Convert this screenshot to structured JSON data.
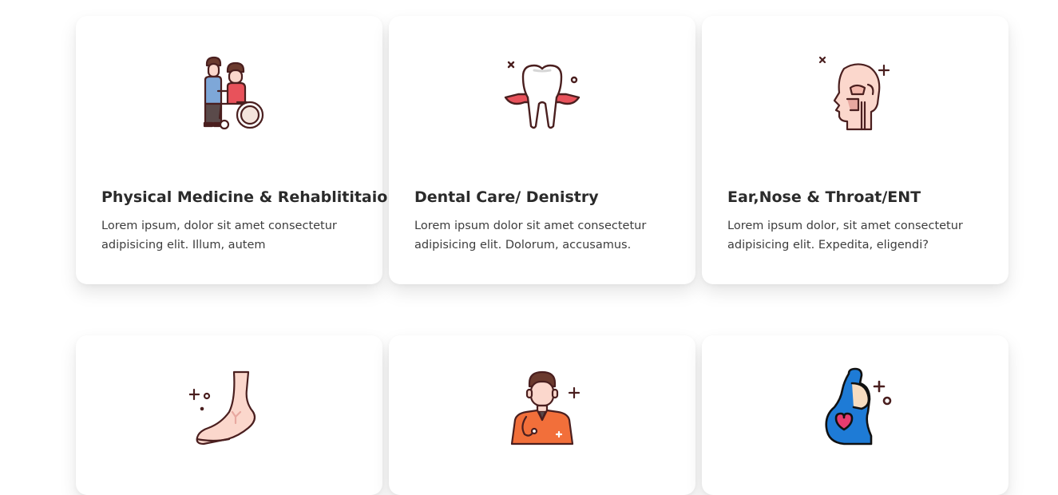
{
  "services": [
    {
      "title": "Physical Medicine & Rehablititaion",
      "description": "Lorem ipsum, dolor sit amet consectetur adipisicing elit. Illum, autem",
      "icon": "wheelchair-rehab-icon"
    },
    {
      "title": "Dental Care/ Denistry",
      "description": "Lorem ipsum dolor sit amet consectetur adipisicing elit. Dolorum, accusamus.",
      "icon": "tooth-icon"
    },
    {
      "title": "Ear,Nose & Throat/ENT",
      "description": "Lorem ipsum dolor, sit amet consectetur adipisicing elit. Expedita, eligendi?",
      "icon": "head-anatomy-icon"
    },
    {
      "title": "",
      "description": "",
      "icon": "foot-icon"
    },
    {
      "title": "",
      "description": "",
      "icon": "doctor-icon"
    },
    {
      "title": "",
      "description": "",
      "icon": "pregnancy-icon"
    }
  ],
  "colors": {
    "outline": "#4a1f1f",
    "skin": "#fbd7cc",
    "accent_red": "#e8525b",
    "accent_orange": "#f26f3a",
    "accent_blue": "#1e7bd6",
    "heart": "#e83c6f"
  }
}
